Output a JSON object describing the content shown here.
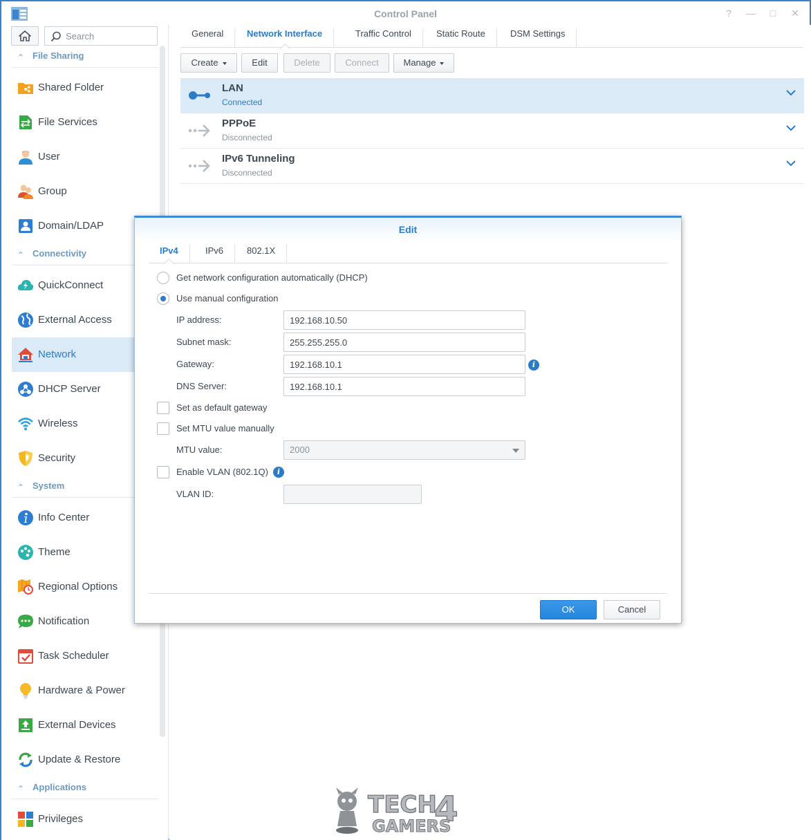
{
  "window": {
    "title": "Control Panel"
  },
  "sidebar": {
    "search_placeholder": "Search",
    "sections": [
      {
        "label": "File Sharing",
        "items": [
          {
            "label": "Shared Folder",
            "icon": "shared-folder-icon"
          },
          {
            "label": "File Services",
            "icon": "file-services-icon"
          },
          {
            "label": "User",
            "icon": "user-icon"
          },
          {
            "label": "Group",
            "icon": "group-icon"
          },
          {
            "label": "Domain/LDAP",
            "icon": "domain-ldap-icon"
          }
        ]
      },
      {
        "label": "Connectivity",
        "items": [
          {
            "label": "QuickConnect",
            "icon": "quickconnect-icon"
          },
          {
            "label": "External Access",
            "icon": "external-access-icon"
          },
          {
            "label": "Network",
            "icon": "network-icon",
            "active": true
          },
          {
            "label": "DHCP Server",
            "icon": "dhcp-server-icon"
          },
          {
            "label": "Wireless",
            "icon": "wireless-icon"
          },
          {
            "label": "Security",
            "icon": "security-icon"
          }
        ]
      },
      {
        "label": "System",
        "items": [
          {
            "label": "Info Center",
            "icon": "info-center-icon"
          },
          {
            "label": "Theme",
            "icon": "theme-icon"
          },
          {
            "label": "Regional Options",
            "icon": "regional-options-icon"
          },
          {
            "label": "Notification",
            "icon": "notification-icon"
          },
          {
            "label": "Task Scheduler",
            "icon": "task-scheduler-icon"
          },
          {
            "label": "Hardware & Power",
            "icon": "hardware-power-icon"
          },
          {
            "label": "External Devices",
            "icon": "external-devices-icon"
          },
          {
            "label": "Update & Restore",
            "icon": "update-restore-icon"
          }
        ]
      },
      {
        "label": "Applications",
        "items": [
          {
            "label": "Privileges",
            "icon": "privileges-icon"
          }
        ]
      }
    ]
  },
  "main": {
    "tabs": [
      "General",
      "Network Interface",
      "Traffic Control",
      "Static Route",
      "DSM Settings"
    ],
    "active_tab": "Network Interface",
    "toolbar": {
      "create": "Create",
      "edit": "Edit",
      "delete": "Delete",
      "connect": "Connect",
      "manage": "Manage"
    },
    "interfaces": [
      {
        "name": "LAN",
        "status": "Connected",
        "active": true
      },
      {
        "name": "PPPoE",
        "status": "Disconnected"
      },
      {
        "name": "IPv6 Tunneling",
        "status": "Disconnected"
      }
    ]
  },
  "dialog": {
    "title": "Edit",
    "tabs": [
      "IPv4",
      "IPv6",
      "802.1X"
    ],
    "active_tab": "IPv4",
    "dhcp_label": "Get network configuration automatically (DHCP)",
    "manual_label": "Use manual configuration",
    "ip_label": "IP address:",
    "ip_value": "192.168.10.50",
    "subnet_label": "Subnet mask:",
    "subnet_value": "255.255.255.0",
    "gateway_label": "Gateway:",
    "gateway_value": "192.168.10.1",
    "dns_label": "DNS Server:",
    "dns_value": "192.168.10.1",
    "default_gateway_label": "Set as default gateway",
    "mtu_manual_label": "Set MTU value manually",
    "mtu_label": "MTU value:",
    "mtu_value": "2000",
    "vlan_label": "Enable VLAN (802.1Q)",
    "vlan_id_label": "VLAN ID:",
    "vlan_id_value": "",
    "ok": "OK",
    "cancel": "Cancel"
  },
  "watermark": {
    "line1": "TECH",
    "line2": "GAMERS",
    "digit": "4"
  },
  "colors": {
    "accent": "#2a7cc7",
    "active_bg": "#dbeaf7",
    "window_border": "#3a83cc"
  }
}
